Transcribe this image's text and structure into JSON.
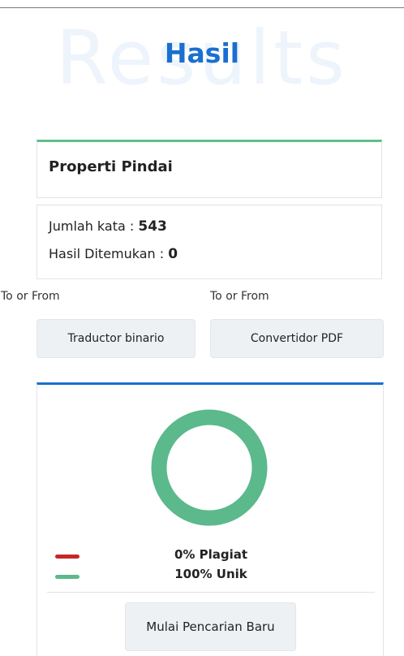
{
  "hero": {
    "background_text": "Results",
    "title": "Hasil"
  },
  "scan_properties": {
    "title": "Properti Pindai"
  },
  "stats": {
    "word_count_label": "Jumlah kata : ",
    "word_count_value": "543",
    "results_found_label": "Hasil Ditemukan : ",
    "results_found_value": "0"
  },
  "tools": [
    {
      "caption": "To or From",
      "button_label": "Traductor binario"
    },
    {
      "caption": "To or From",
      "button_label": "Convertidor PDF"
    }
  ],
  "result": {
    "plagiarism_percent": 0,
    "unique_percent": 100,
    "plagiarism_label": "0% Plagiat",
    "unique_label": "100% Unik",
    "new_search_label": "Mulai Pencarian Baru"
  },
  "colors": {
    "accent_blue": "#1a6fd0",
    "accent_green": "#5fbf8a",
    "plagiarism_red": "#c62828",
    "unique_green": "#5bb98b"
  }
}
